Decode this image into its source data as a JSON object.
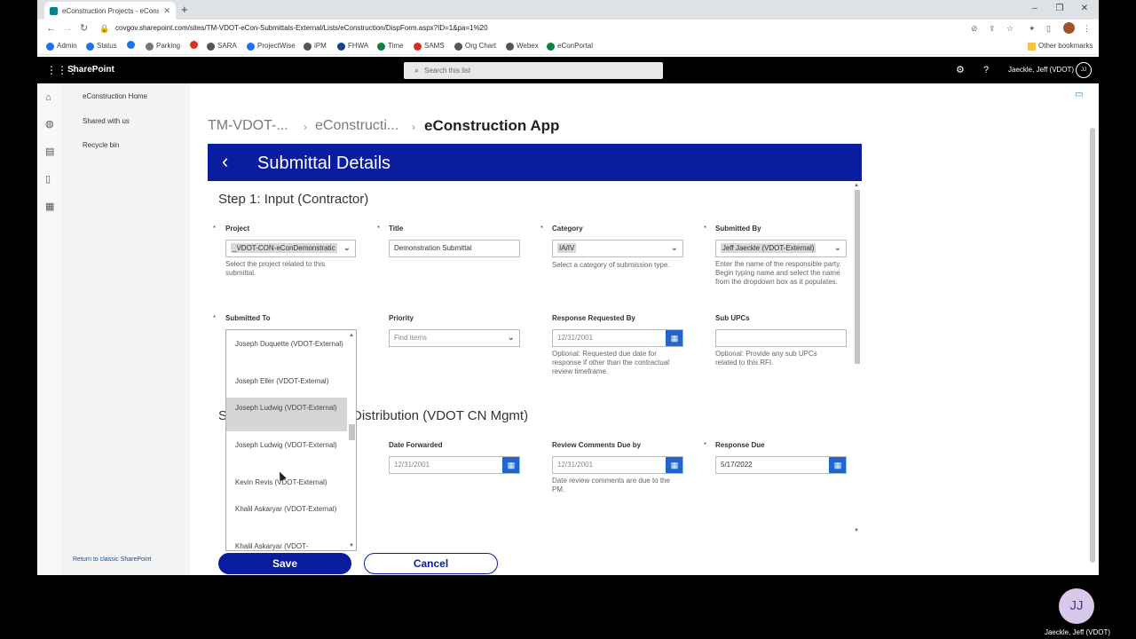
{
  "browser": {
    "tab_title": "eConstruction Projects - eConstr",
    "new_tab": "+",
    "win_min": "–",
    "win_restore": "❐",
    "win_close": "✕",
    "url": "covgov.sharepoint.com/sites/TM-VDOT-eCon-Submittals-External/Lists/eConstruction/DispForm.aspx?ID=1&pa=1%20",
    "bookmarks": [
      "Admin",
      "Status",
      "Parking",
      "SARA",
      "ProjectWise",
      "iPM",
      "FHWA",
      "Time",
      "SAMS",
      "Org Chart",
      "Webex",
      "eConPortal"
    ],
    "other_bookmarks": "Other bookmarks"
  },
  "suite": {
    "brand": "SharePoint",
    "search_placeholder": "Search this list",
    "user_name": "Jaeckle, Jeff (VDOT)",
    "user_initials": "JJ"
  },
  "leftnav": {
    "items": [
      "eConstruction Home",
      "Shared with us",
      "Recycle bin"
    ],
    "classic": "Return to classic SharePoint"
  },
  "breadcrumb": {
    "items": [
      "TM-VDOT-...",
      "eConstructi...",
      "eConstruction App"
    ]
  },
  "app": {
    "header_title": "Submittal Details",
    "step1": "Step 1:  Input (Contractor)",
    "step2_left": "S",
    "step2_right": "Distribution (VDOT CN Mgmt)",
    "fields": {
      "project": {
        "label": "Project",
        "value": "_VDOT-CON-eConDemonstratic",
        "help": "Select the project related to this submittal."
      },
      "title": {
        "label": "Title",
        "value": "Demonstration Submittal"
      },
      "category": {
        "label": "Category",
        "value": "IA/IV",
        "help": "Select a category of submission type."
      },
      "submitted_by": {
        "label": "Submitted By",
        "value": "Jeff Jaeckle (VDOT-External)",
        "help": "Enter the name of the responsible party. Begin typing name and select the name from the dropdown box as it populates."
      },
      "submitted_to": {
        "label": "Submitted To"
      },
      "priority": {
        "label": "Priority",
        "placeholder": "Find items"
      },
      "response_requested_by": {
        "label": "Response Requested By",
        "value": "12/31/2001",
        "help": "Optional: Requested due date for response if other than the contractual review timeframe."
      },
      "sub_upcs": {
        "label": "Sub UPCs",
        "value": "",
        "help": "Optional: Provide any sub UPCs related to this RFI."
      },
      "date_forwarded": {
        "label": "Date Forwarded",
        "value": "12/31/2001"
      },
      "review_comments_due": {
        "label": "Review Comments Due by",
        "value": "12/31/2001",
        "help": "Date review comments are due to the PM."
      },
      "response_due": {
        "label": "Response Due",
        "value": "5/17/2022"
      }
    },
    "dropdown_items": [
      "Joseph Duquette (VDOT-External)",
      "Joseph Eller (VDOT-External)",
      "Joseph Ludwig (VDOT-External)",
      "Joseph Ludwig (VDOT-External)",
      "Kevin Revis (VDOT-External)",
      "Khalil Askaryar (VDOT-External)",
      "Khalil Askaryar (VDOT-"
    ],
    "save_label": "Save",
    "cancel_label": "Cancel"
  },
  "participant": {
    "initials": "JJ",
    "name": "Jaeckle, Jeff (VDOT)"
  }
}
